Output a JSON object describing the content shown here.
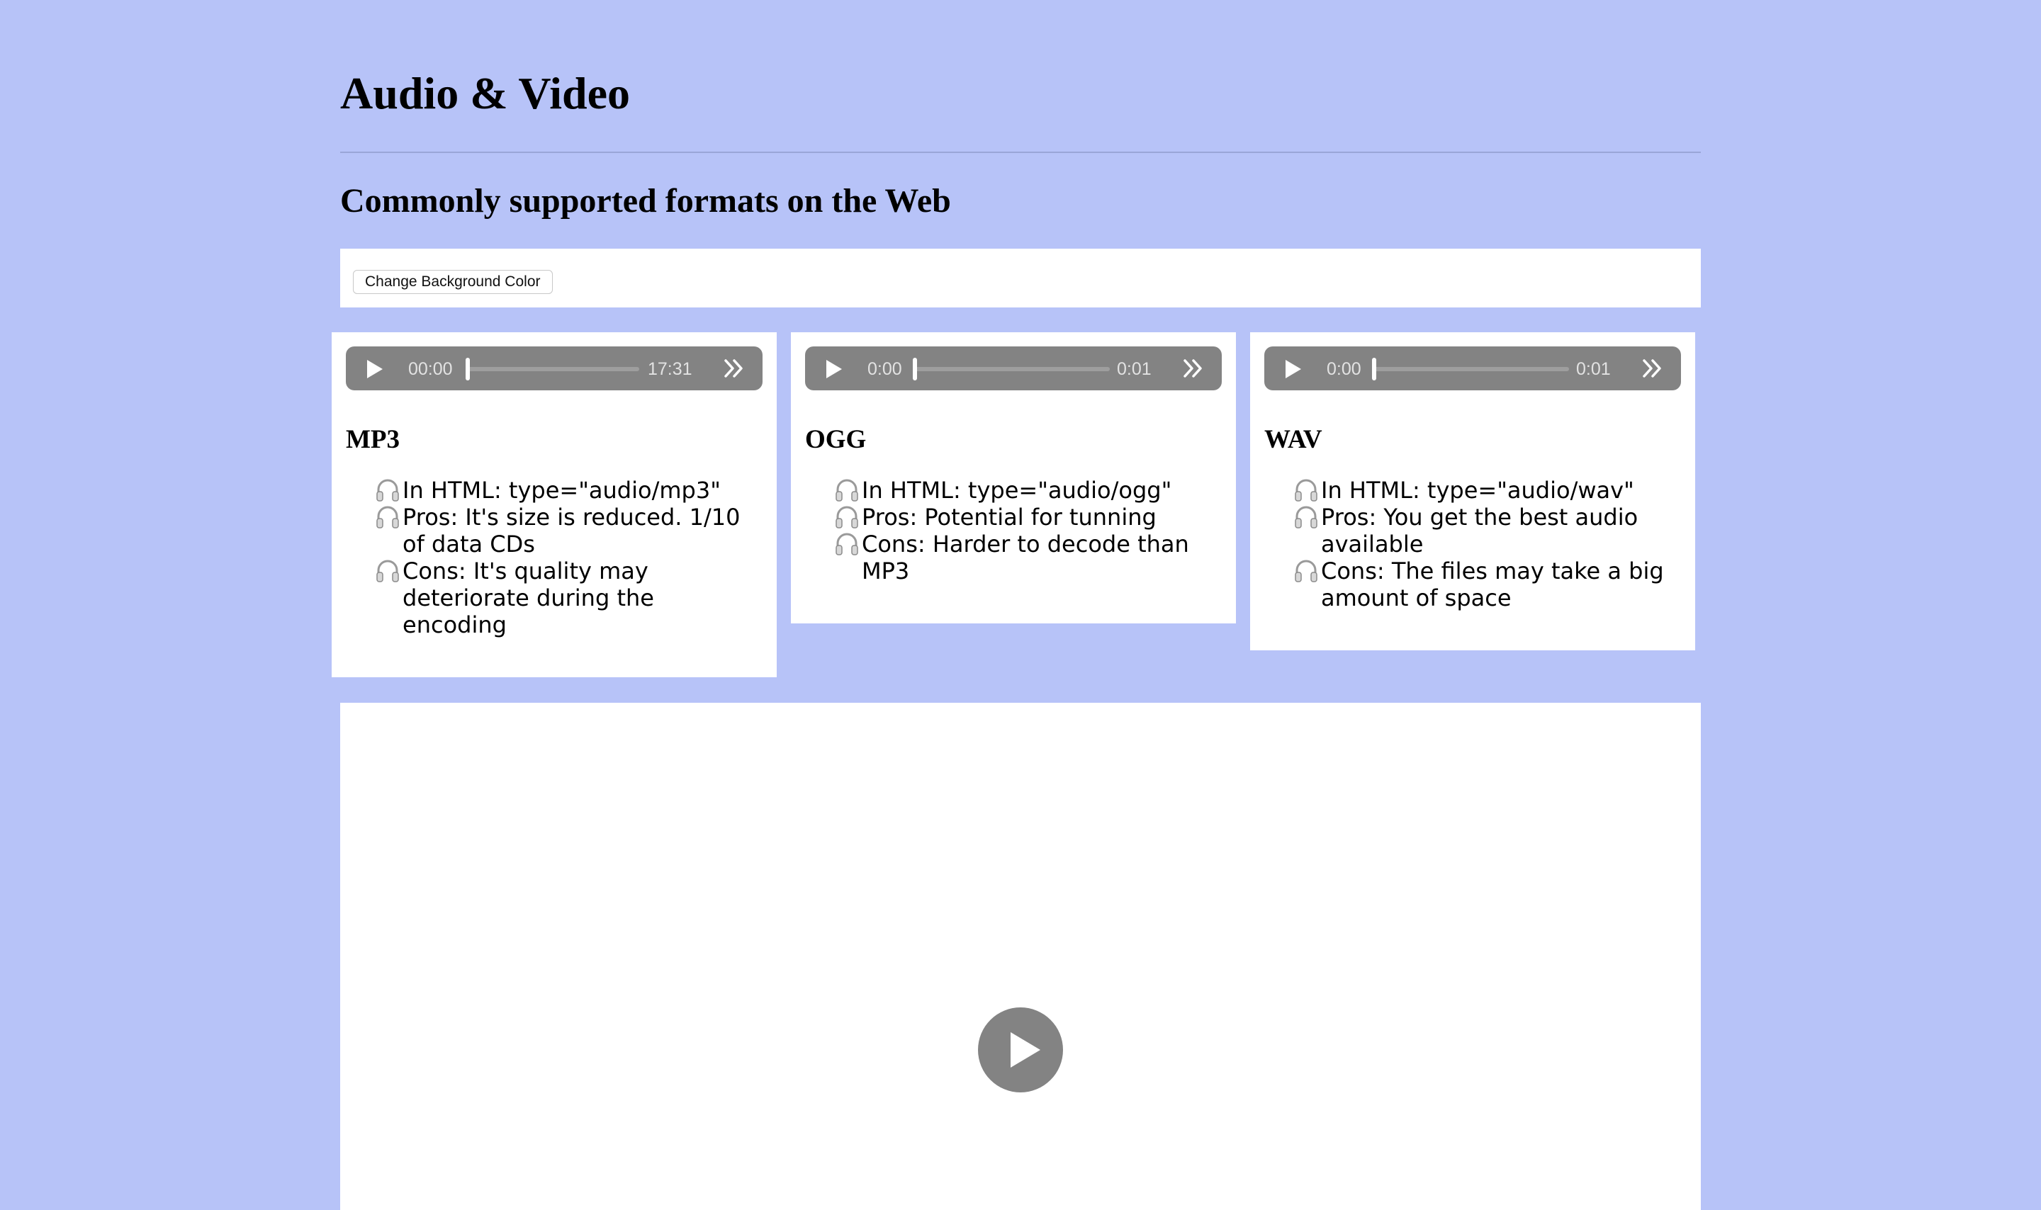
{
  "page": {
    "title": "Audio & Video",
    "subtitle": "Commonly supported formats on the Web",
    "background_color": "#b7c3f8"
  },
  "toolbar": {
    "change_bg_label": "Change Background Color"
  },
  "cards": [
    {
      "title": "MP3",
      "player": {
        "current_time": "00:00",
        "duration": "17:31"
      },
      "items": [
        "In HTML: type=\"audio/mp3\"",
        "Pros: It's size is reduced. 1/10 of data CDs",
        "Cons: It's quality may deteriorate during the encoding"
      ]
    },
    {
      "title": "OGG",
      "player": {
        "current_time": "0:00",
        "duration": "0:01"
      },
      "items": [
        "In HTML: type=\"audio/ogg\"",
        "Pros: Potential for tunning",
        "Cons: Harder to decode than MP3"
      ]
    },
    {
      "title": "WAV",
      "player": {
        "current_time": "0:00",
        "duration": "0:01"
      },
      "items": [
        "In HTML: type=\"audio/wav\"",
        "Pros: You get the best audio available",
        "Cons: The files may take a big amount of space"
      ]
    }
  ],
  "icons": {
    "list_bullet": "headphones-icon",
    "player_play": "play-icon",
    "player_more": "chevron-double-right-icon",
    "video_play": "play-icon"
  }
}
